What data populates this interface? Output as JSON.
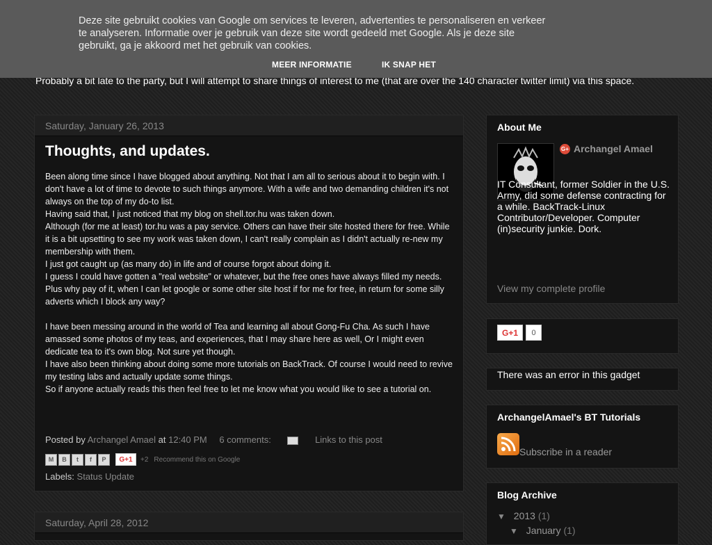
{
  "cookie": {
    "text": "Deze site gebruikt cookies van Google om services te leveren, advertenties te personaliseren en verkeer te analyseren. Informatie over je gebruik van deze site wordt gedeeld met Google. Als je deze site gebruikt, ga je akkoord met het gebruik van cookies.",
    "more_label": "MEER INFORMATIE",
    "ok_label": "IK SNAP HET"
  },
  "blog": {
    "description": "Probably a bit late to the party, but I will attempt to share things of interest to me (that are over the 140 character twitter limit) via this space."
  },
  "post": {
    "date": "Saturday, January 26, 2013",
    "title": "Thoughts, and updates.",
    "paragraphs": [
      "Been along time since I have blogged about anything. Not that I am all to serious about it to begin with. I don't have a lot of time to devote to such things anymore. With a wife and two demanding children it's not always on the top of my do-to list.",
      "Having said that, I just noticed that my blog on shell.tor.hu was taken down.",
      "Although (for me at least) tor.hu was a pay service. Others can have their site hosted there for free. While it is a bit upsetting to see my work was taken down, I can't really complain as I didn't actually re-new my membership with them.",
      "I just got caught up (as many do) in life and of course forgot about doing it.",
      "I guess I could have gotten a \"real website\" or whatever, but the free ones have always filled my needs. Plus why pay of it, when I can let google or some other site host if for me for free, in return for some silly adverts which I block any way?",
      "",
      "I have been messing around in the world of Tea and learning all about Gong-Fu Cha.  As such I have amassed some photos of my teas, and experiences, that I may share here as well, Or I might even dedicate tea to it's own blog. Not sure yet though.",
      "I have also been thinking about doing some more tutorials on BackTrack. Of course I would need to revive my testing labs and actually update some things.",
      "So if anyone actually reads this then feel free to let me know what you would like to see a tutorial on."
    ],
    "posted_by_label": "Posted by",
    "author": "Archangel Amael",
    "at_label": "at",
    "time": "12:40 PM",
    "comments": "6 comments:",
    "links_label": "Links to this post",
    "share_buttons": [
      "M",
      "B",
      "t",
      "f",
      "P"
    ],
    "gplus_label": "G+1",
    "plus_count": "+2",
    "recommend": "Recommend this on Google",
    "labels_label": "Labels:",
    "label": "Status Update"
  },
  "post2": {
    "date": "Saturday, April 28, 2012"
  },
  "sidebar": {
    "about": {
      "title": "About Me",
      "name": "Archangel Amael",
      "gp_icon": "G+",
      "bio": "IT Consultant, former Soldier in the U.S. Army, did some defense contracting for a while. BackTrack-Linux Contributor/Developer. Computer (in)security junkie. Dork.",
      "view_profile": "View my complete profile"
    },
    "plusone": {
      "label": "G+1",
      "count": "0"
    },
    "error": {
      "text": "There was an error in this gadget"
    },
    "tutorials": {
      "title": "ArchangelAmael's BT Tutorials",
      "subscribe": "Subscribe in a reader"
    },
    "archive": {
      "title": "Blog Archive",
      "year": "2013",
      "year_count": "(1)",
      "month": "January",
      "month_count": "(1)",
      "toggle": "▼"
    }
  }
}
